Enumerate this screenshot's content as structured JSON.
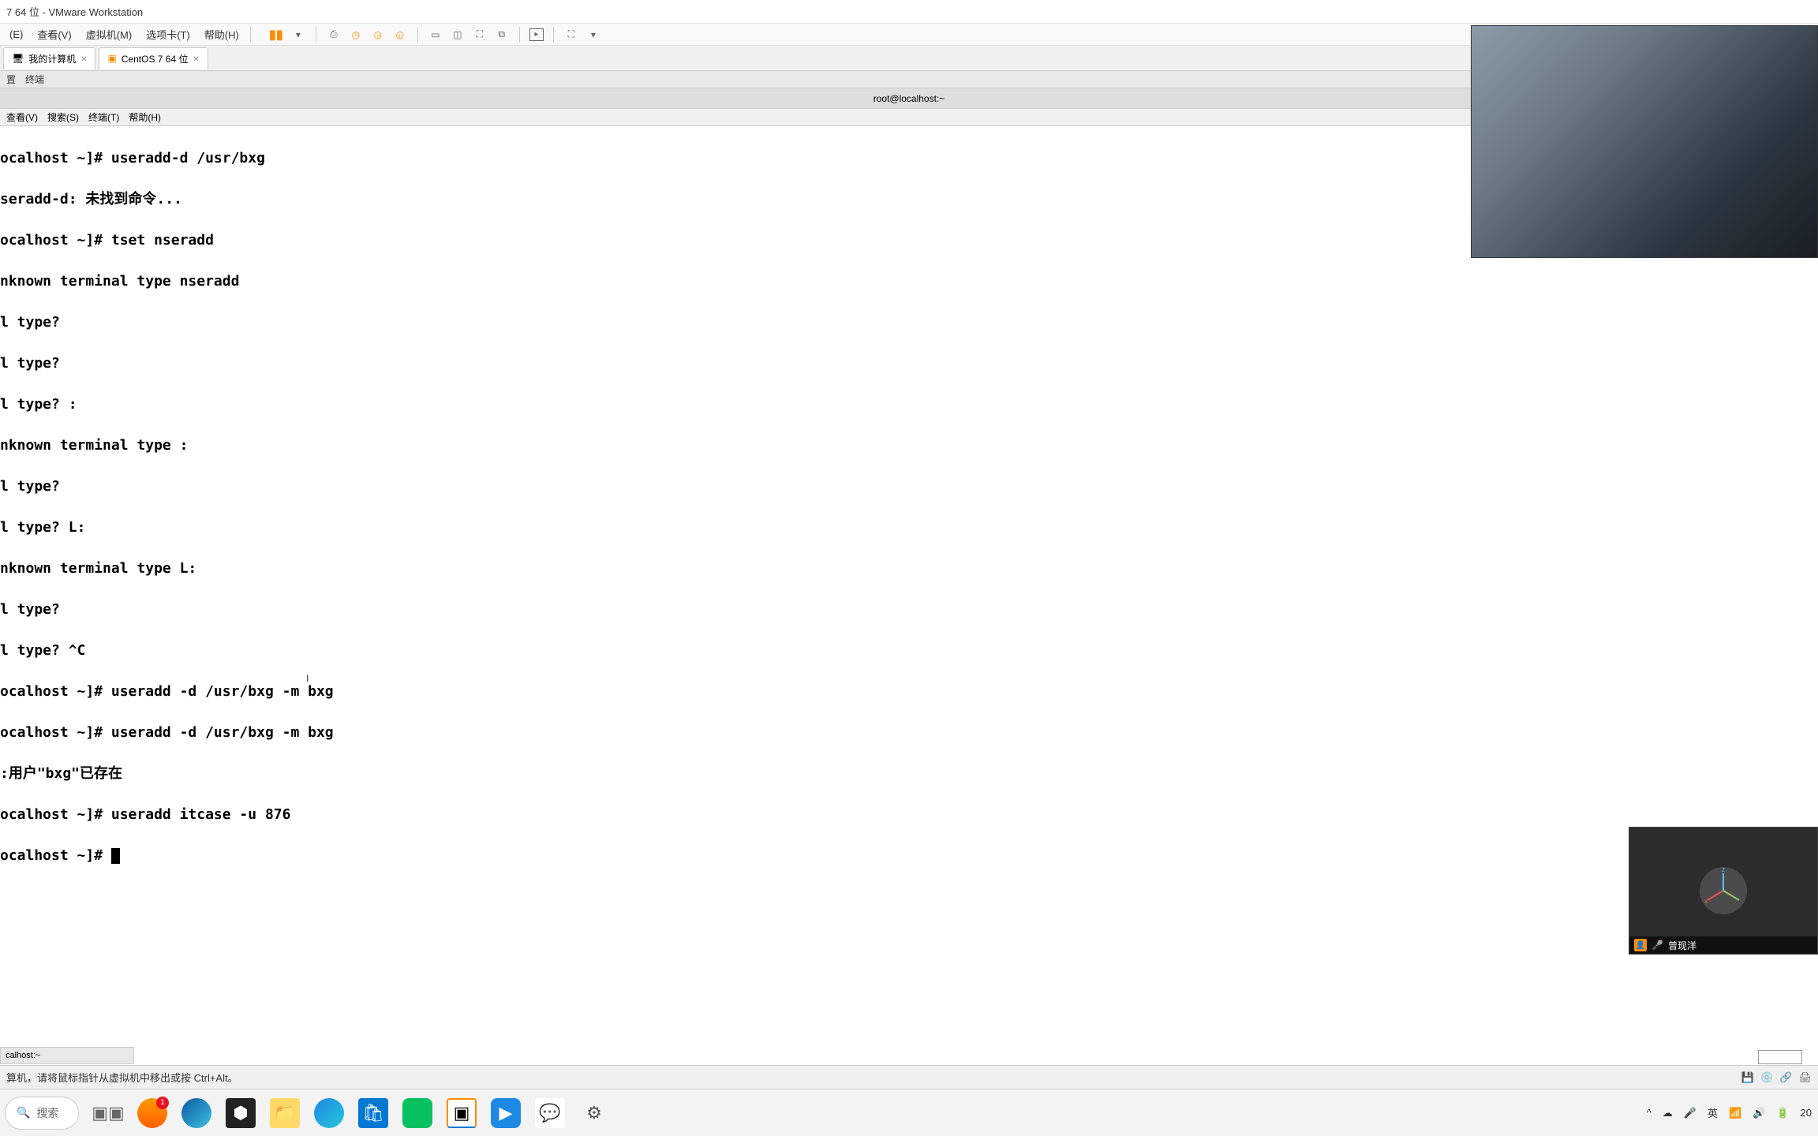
{
  "window": {
    "title": "7 64 位 - VMware Workstation"
  },
  "menu": {
    "edit": "(E)",
    "view": "查看(V)",
    "vm": "虚拟机(M)",
    "tabs": "选项卡(T)",
    "help": "帮助(H)"
  },
  "tabs": {
    "home": "我的计算机",
    "vm": "CentOS 7 64 位"
  },
  "submenu": {
    "item1": "置",
    "item2": "终端"
  },
  "term_title": "root@localhost:~",
  "term_menu": {
    "view": "查看(V)",
    "search": "搜索(S)",
    "terminal": "终端(T)",
    "help": "帮助(H)"
  },
  "terminal_lines": [
    "ocalhost ~]# useradd-d /usr/bxg",
    "seradd-d: 未找到命令...",
    "ocalhost ~]# tset nseradd",
    "nknown terminal type nseradd",
    "l type?",
    "l type?",
    "l type? :",
    "nknown terminal type :",
    "l type?",
    "l type? L:",
    "nknown terminal type L:",
    "l type?",
    "l type? ^C",
    "ocalhost ~]# useradd -d /usr/bxg -m bxg",
    "ocalhost ~]# useradd -d /usr/bxg -m bxg",
    ":用户\"bxg\"已存在",
    "ocalhost ~]# useradd itcase -u 876",
    "ocalhost ~]# "
  ],
  "mini_panel": {
    "name": "曾现洋"
  },
  "bottom_tab": "calhost:~",
  "statusbar": {
    "hint": "算机，请将鼠标指针从虚拟机中移出或按 Ctrl+Alt。"
  },
  "taskbar": {
    "search": "搜索"
  },
  "tray": {
    "ime": "英",
    "time_suffix": "20"
  }
}
